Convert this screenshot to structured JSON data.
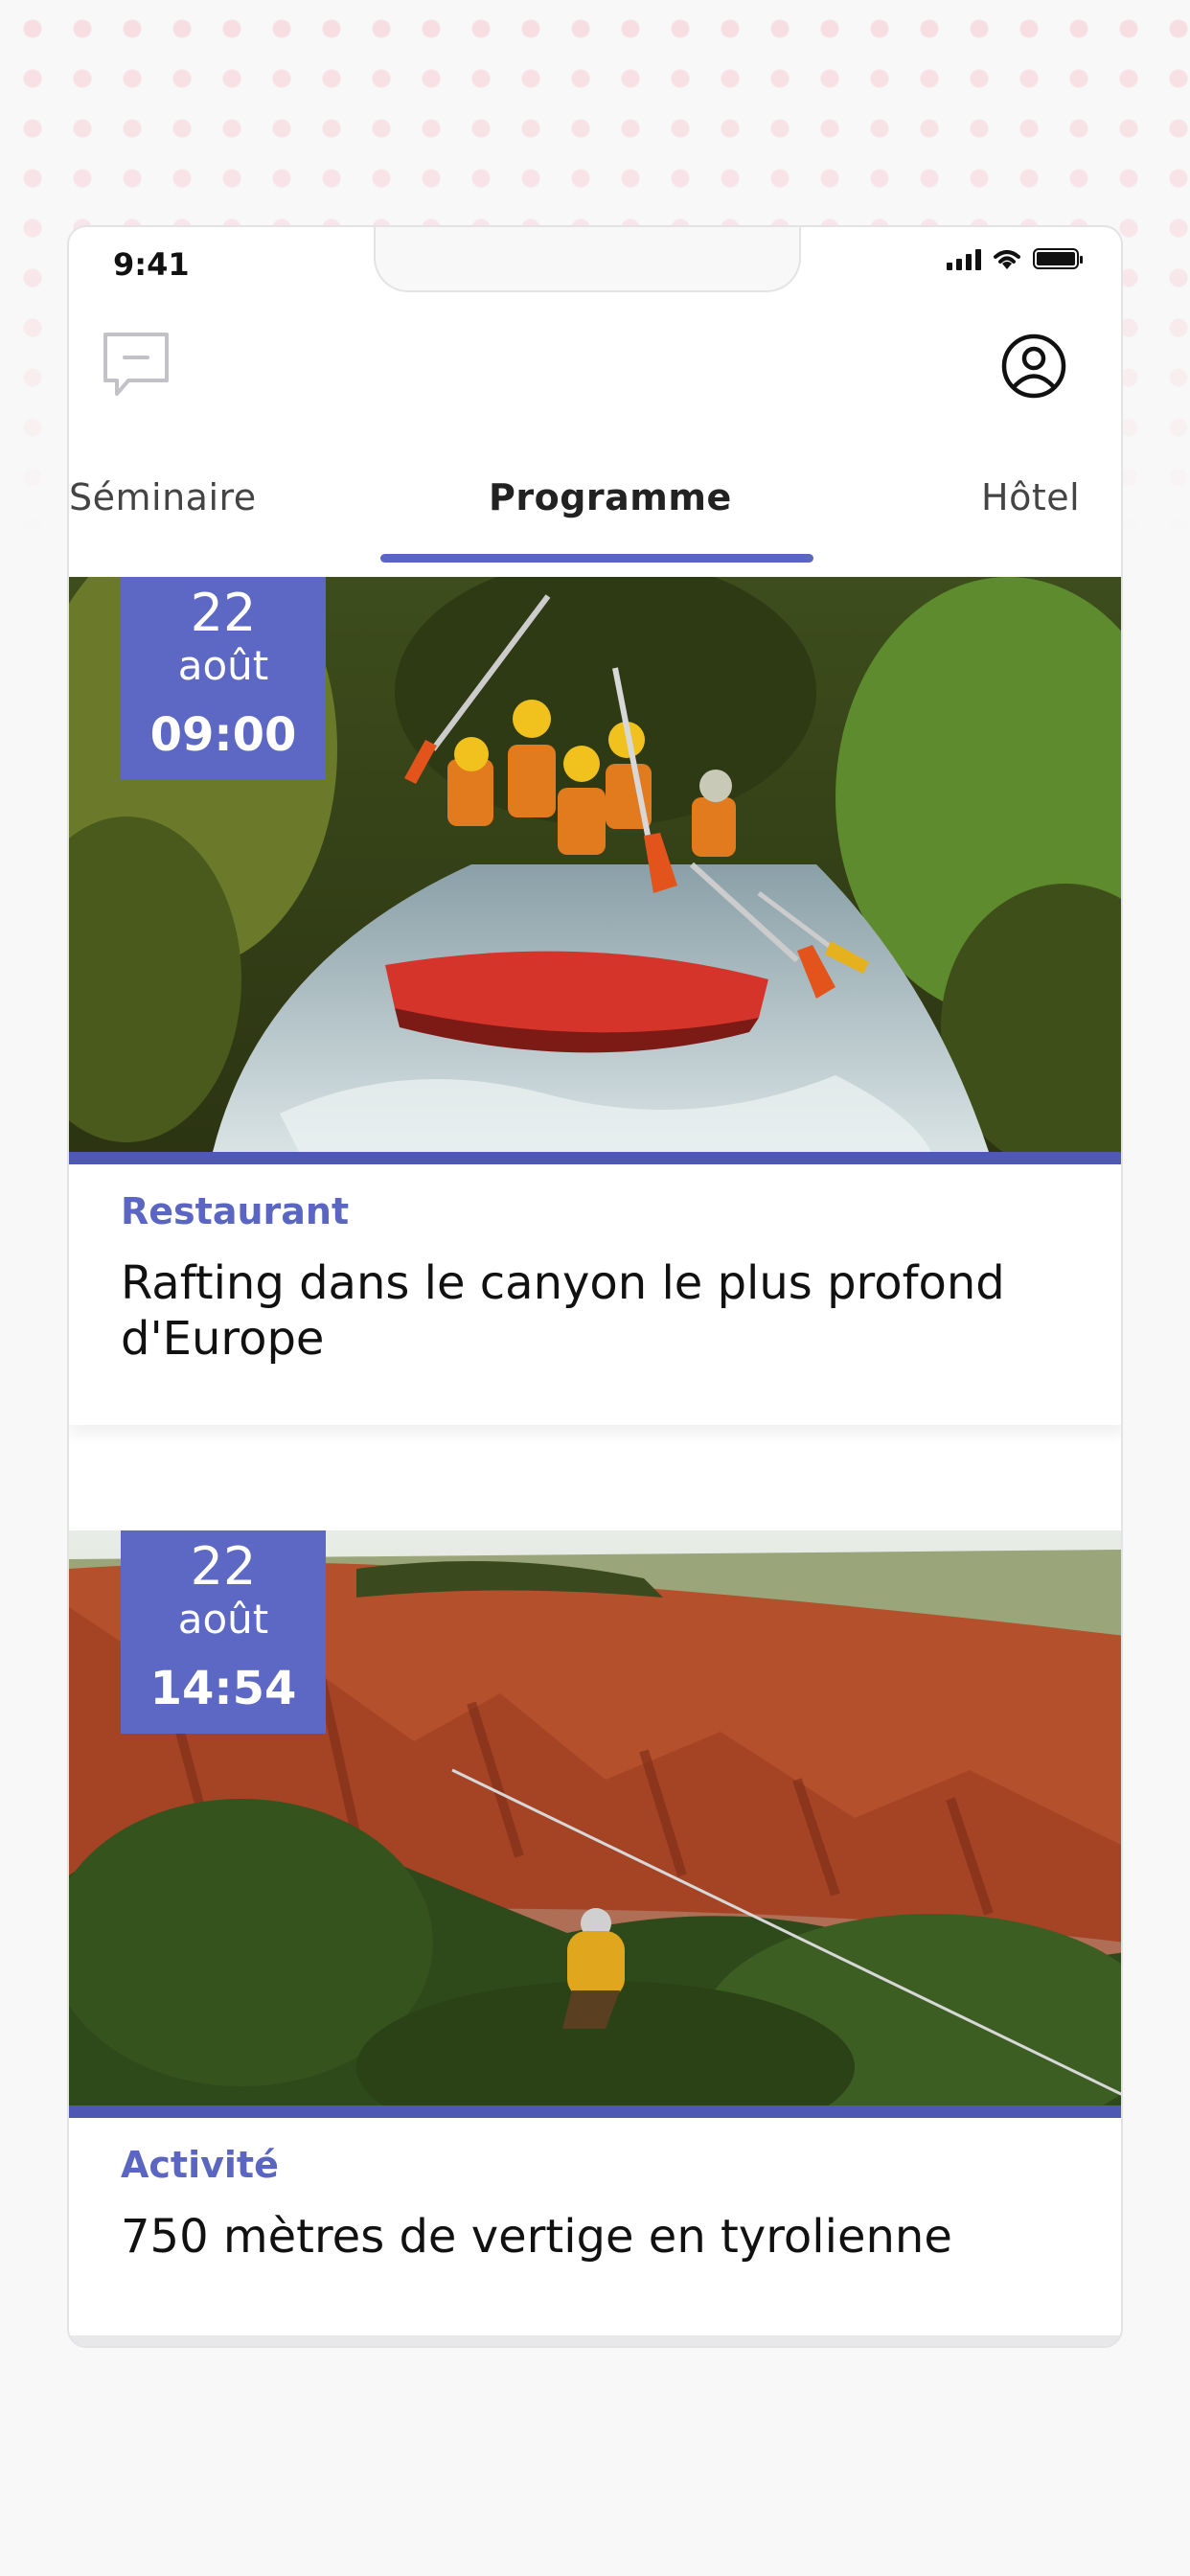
{
  "status_bar": {
    "time": "9:41"
  },
  "header": {
    "chat_icon": "chat-bubble-icon",
    "profile_icon": "user-circle-icon"
  },
  "tabs": [
    {
      "label": "Séminaire",
      "active": false
    },
    {
      "label": "Programme",
      "active": true
    },
    {
      "label": "Hôtel",
      "active": false
    }
  ],
  "accent_color": "#5b66c2",
  "events": [
    {
      "day": "22",
      "month": "août",
      "time": "09:00",
      "category": "Restaurant",
      "title": "Rafting dans le canyon le plus profond d'Europe",
      "image": "rafting-photo"
    },
    {
      "day": "22",
      "month": "août",
      "time": "14:54",
      "category": "Activité",
      "title": "750 mètres de vertige en tyrolienne",
      "image": "zipline-canyon-photo"
    }
  ]
}
